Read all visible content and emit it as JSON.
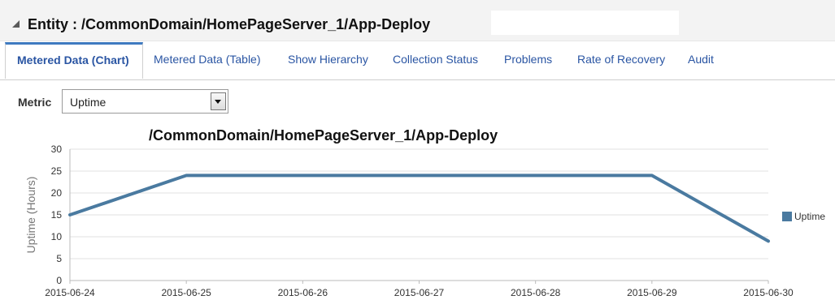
{
  "header": {
    "entity_label": "Entity : /CommonDomain/HomePageServer_1/App-Deploy"
  },
  "tabs": [
    {
      "label": "Metered Data (Chart)",
      "active": true
    },
    {
      "label": "Metered Data (Table)",
      "active": false
    },
    {
      "label": "Show Hierarchy",
      "active": false
    },
    {
      "label": "Collection Status",
      "active": false
    },
    {
      "label": "Problems",
      "active": false
    },
    {
      "label": "Rate of Recovery",
      "active": false
    },
    {
      "label": "Audit",
      "active": false
    }
  ],
  "metric": {
    "label": "Metric",
    "selected": "Uptime"
  },
  "colors": {
    "series": "#4a7aa0",
    "tab_link": "#2a55a3",
    "tab_accent": "#3f7ac0",
    "axis_text": "#777777"
  },
  "icons": {
    "collapse": "triangle-collapse-icon",
    "dropdown": "chevron-down-icon"
  },
  "chart_data": {
    "type": "line",
    "title": "/CommonDomain/HomePageServer_1/App-Deploy",
    "xlabel": "",
    "ylabel": "Uptime (Hours)",
    "x": [
      "2015-06-24",
      "2015-06-25",
      "2015-06-26",
      "2015-06-27",
      "2015-06-28",
      "2015-06-29",
      "2015-06-30"
    ],
    "ylim": [
      0,
      30
    ],
    "yticks": [
      0,
      5,
      10,
      15,
      20,
      25,
      30
    ],
    "series": [
      {
        "name": "Uptime",
        "points": [
          {
            "x": "2015-06-24T00:00",
            "y": 15
          },
          {
            "x": "2015-06-25T00:00",
            "y": 24
          },
          {
            "x": "2015-06-29T00:00",
            "y": 24
          },
          {
            "x": "2015-06-30T00:00",
            "y": 9
          }
        ]
      }
    ],
    "legend": "right",
    "grid": true
  }
}
